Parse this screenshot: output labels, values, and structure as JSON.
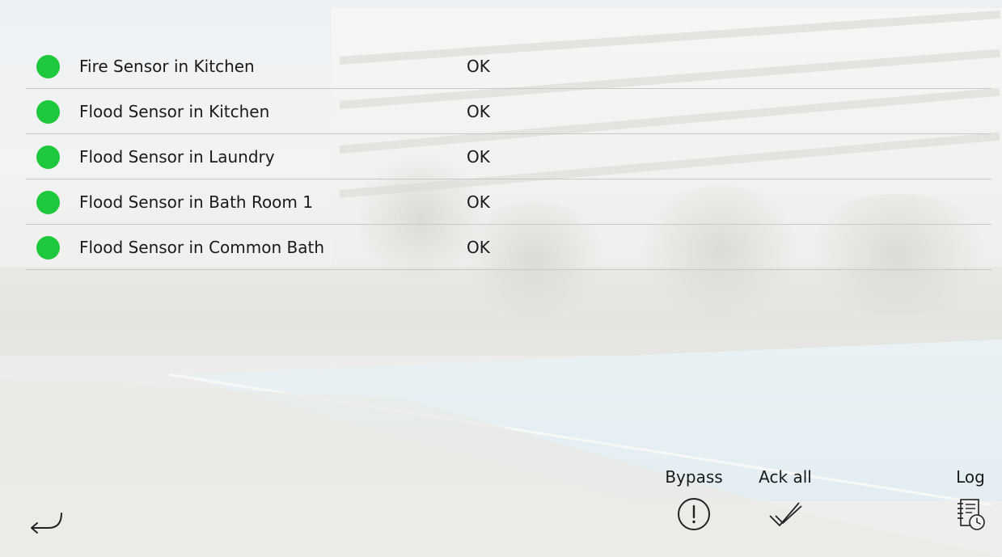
{
  "sensors": [
    {
      "name": "Fire Sensor in Kitchen",
      "status": "OK",
      "indicator_color": "#1ec83c"
    },
    {
      "name": "Flood Sensor in Kitchen",
      "status": "OK",
      "indicator_color": "#1ec83c"
    },
    {
      "name": "Flood Sensor in Laundry",
      "status": "OK",
      "indicator_color": "#1ec83c"
    },
    {
      "name": "Flood Sensor in Bath Room 1",
      "status": "OK",
      "indicator_color": "#1ec83c"
    },
    {
      "name": "Flood Sensor in Common Bath",
      "status": "OK",
      "indicator_color": "#1ec83c"
    }
  ],
  "toolbar": {
    "back_icon": "back-arrow-icon",
    "bypass_label": "Bypass",
    "bypass_icon": "exclamation-circle-icon",
    "ack_all_label": "Ack all",
    "ack_all_icon": "double-check-icon",
    "log_label": "Log",
    "log_icon": "log-clock-icon"
  }
}
